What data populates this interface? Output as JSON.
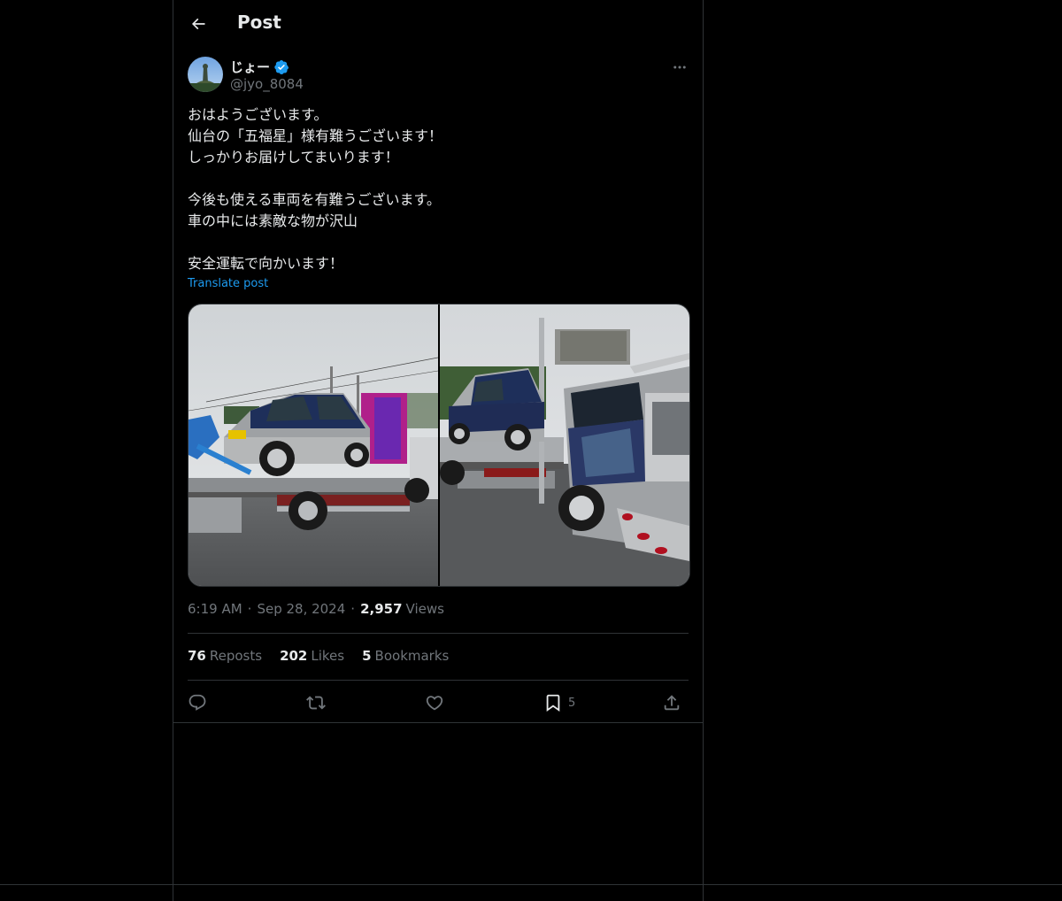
{
  "header": {
    "title": "Post"
  },
  "author": {
    "display_name": "じょー",
    "handle": "@jyo_8084",
    "verified": true
  },
  "tweet": {
    "lines": [
      "おはようございます。",
      "仙台の「五福星」様有難うございます！",
      "しっかりお届けしてまいります！",
      "",
      "今後も使える車両を有難うございます。",
      "車の中には素敵な物が沢山",
      "",
      "安全運転で向かいます！"
    ],
    "translate_label": "Translate post"
  },
  "media": {
    "photos": [
      "truck-side-photo",
      "truck-front-photo"
    ]
  },
  "meta": {
    "time": "6:19 AM",
    "date": "Sep 28, 2024",
    "views_count": "2,957",
    "views_label": "Views"
  },
  "stats": {
    "reposts_count": "76",
    "reposts_label": "Reposts",
    "likes_count": "202",
    "likes_label": "Likes",
    "bookmarks_count": "5",
    "bookmarks_label": "Bookmarks"
  },
  "actions": {
    "bookmark_count": "5"
  },
  "colors": {
    "accent": "#1d9bf0",
    "background": "#000000",
    "muted": "#71767b",
    "text": "#e7e9ea",
    "border": "#2f3336"
  }
}
